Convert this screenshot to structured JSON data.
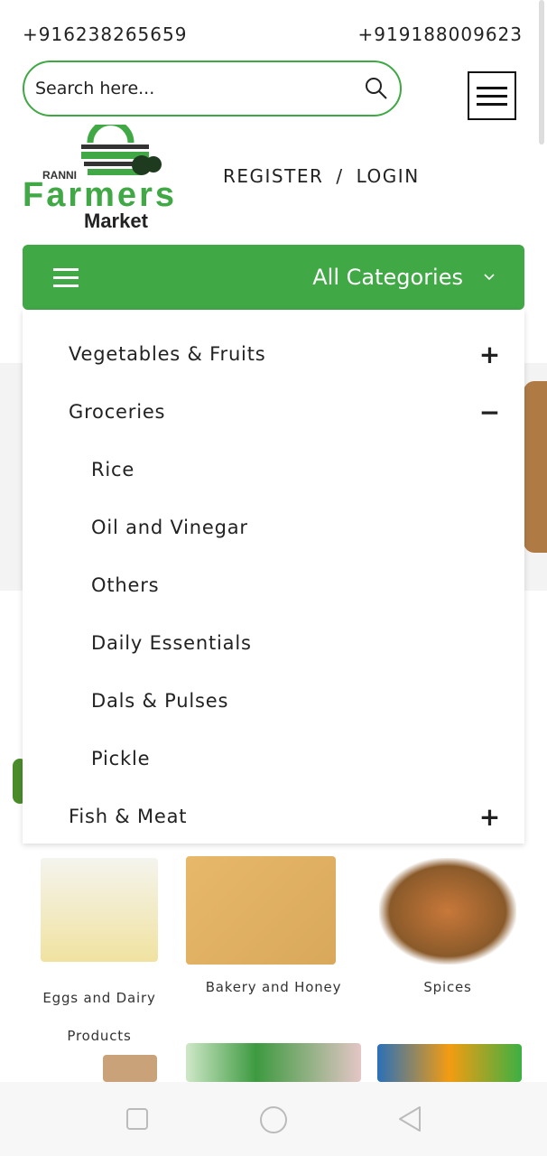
{
  "header": {
    "phone_left": "+916238265659",
    "phone_right": "+919188009623",
    "search_placeholder": "Search here...",
    "logo_text": "RANNI Farmers Market",
    "register": "REGISTER",
    "separator": "/",
    "login": "LOGIN"
  },
  "categories_bar": {
    "label": "All Categories"
  },
  "dropdown": {
    "items": [
      {
        "label": "Vegetables & Fruits",
        "sign": "+"
      },
      {
        "label": "Groceries",
        "sign": "−"
      },
      {
        "label": "Rice"
      },
      {
        "label": "Oil and Vinegar"
      },
      {
        "label": "Others"
      },
      {
        "label": "Daily Essentials"
      },
      {
        "label": "Dals & Pulses"
      },
      {
        "label": "Pickle"
      },
      {
        "label": "Fish & Meat",
        "sign": "+"
      }
    ]
  },
  "tiles": [
    {
      "label": "Eggs and Dairy",
      "label2": "Products"
    },
    {
      "label": "Bakery and Honey"
    },
    {
      "label": "Spices"
    }
  ],
  "colors": {
    "brand_green": "#41a846"
  }
}
